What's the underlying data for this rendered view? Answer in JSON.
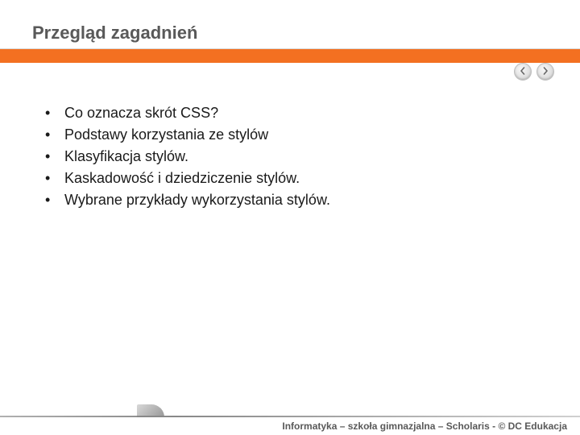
{
  "header": {
    "title": "Przegląd zagadnień"
  },
  "nav": {
    "prev_label": "previous",
    "next_label": "next"
  },
  "bullets": {
    "items": [
      "Co oznacza skrót CSS?",
      "Podstawy korzystania ze stylów",
      "Klasyfikacja stylów.",
      "Kaskadowość i dziedziczenie stylów.",
      "Wybrane przykłady wykorzystania stylów."
    ]
  },
  "footer": {
    "text": "Informatyka – szkoła gimnazjalna – Scholaris - © DC Edukacja"
  },
  "colors": {
    "accent": "#f37021",
    "title": "#595959"
  }
}
